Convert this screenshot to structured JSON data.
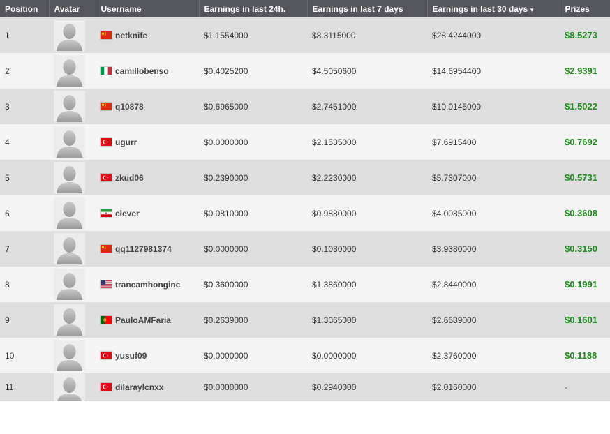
{
  "columns": {
    "position": "Position",
    "avatar": "Avatar",
    "username": "Username",
    "earn_24h": "Earnings in last 24h.",
    "earn_7d": "Earnings in last 7 days",
    "earn_30d": "Earnings in last 30 days",
    "earn_30d_sort_icon": "sort-descending-icon",
    "prizes": "Prizes"
  },
  "rows": [
    {
      "position": "1",
      "flag": "china",
      "username": "netknife",
      "earn_24h": "$1.1554000",
      "earn_7d": "$8.3115000",
      "earn_30d": "$28.4244000",
      "prize": "$8.5273"
    },
    {
      "position": "2",
      "flag": "italy",
      "username": "camillobenso",
      "earn_24h": "$0.4025200",
      "earn_7d": "$4.5050600",
      "earn_30d": "$14.6954400",
      "prize": "$2.9391"
    },
    {
      "position": "3",
      "flag": "china",
      "username": "q10878",
      "earn_24h": "$0.6965000",
      "earn_7d": "$2.7451000",
      "earn_30d": "$10.0145000",
      "prize": "$1.5022"
    },
    {
      "position": "4",
      "flag": "turkey",
      "username": "ugurr",
      "earn_24h": "$0.0000000",
      "earn_7d": "$2.1535000",
      "earn_30d": "$7.6915400",
      "prize": "$0.7692"
    },
    {
      "position": "5",
      "flag": "turkey",
      "username": "zkud06",
      "earn_24h": "$0.2390000",
      "earn_7d": "$2.2230000",
      "earn_30d": "$5.7307000",
      "prize": "$0.5731"
    },
    {
      "position": "6",
      "flag": "iran",
      "username": "clever",
      "earn_24h": "$0.0810000",
      "earn_7d": "$0.9880000",
      "earn_30d": "$4.0085000",
      "prize": "$0.3608"
    },
    {
      "position": "7",
      "flag": "china",
      "username": "qq1127981374",
      "earn_24h": "$0.0000000",
      "earn_7d": "$0.1080000",
      "earn_30d": "$3.9380000",
      "prize": "$0.3150"
    },
    {
      "position": "8",
      "flag": "usa",
      "username": "trancamhonginc",
      "earn_24h": "$0.3600000",
      "earn_7d": "$1.3860000",
      "earn_30d": "$2.8440000",
      "prize": "$0.1991"
    },
    {
      "position": "9",
      "flag": "portugal",
      "username": "PauloAMFaria",
      "earn_24h": "$0.2639000",
      "earn_7d": "$1.3065000",
      "earn_30d": "$2.6689000",
      "prize": "$0.1601"
    },
    {
      "position": "10",
      "flag": "turkey",
      "username": "yusuf09",
      "earn_24h": "$0.0000000",
      "earn_7d": "$0.0000000",
      "earn_30d": "$2.3760000",
      "prize": "$0.1188"
    },
    {
      "position": "11",
      "flag": "turkey",
      "username": "dilaraylcnxx",
      "earn_24h": "$0.0000000",
      "earn_7d": "$0.2940000",
      "earn_30d": "$2.0160000",
      "prize": "-"
    }
  ],
  "avatar_icon": "default-user-avatar-icon",
  "colors": {
    "header_bg": "#555659",
    "row_odd": "#dedede",
    "row_even": "#f4f4f4",
    "prize_green": "#1f8a1f"
  }
}
